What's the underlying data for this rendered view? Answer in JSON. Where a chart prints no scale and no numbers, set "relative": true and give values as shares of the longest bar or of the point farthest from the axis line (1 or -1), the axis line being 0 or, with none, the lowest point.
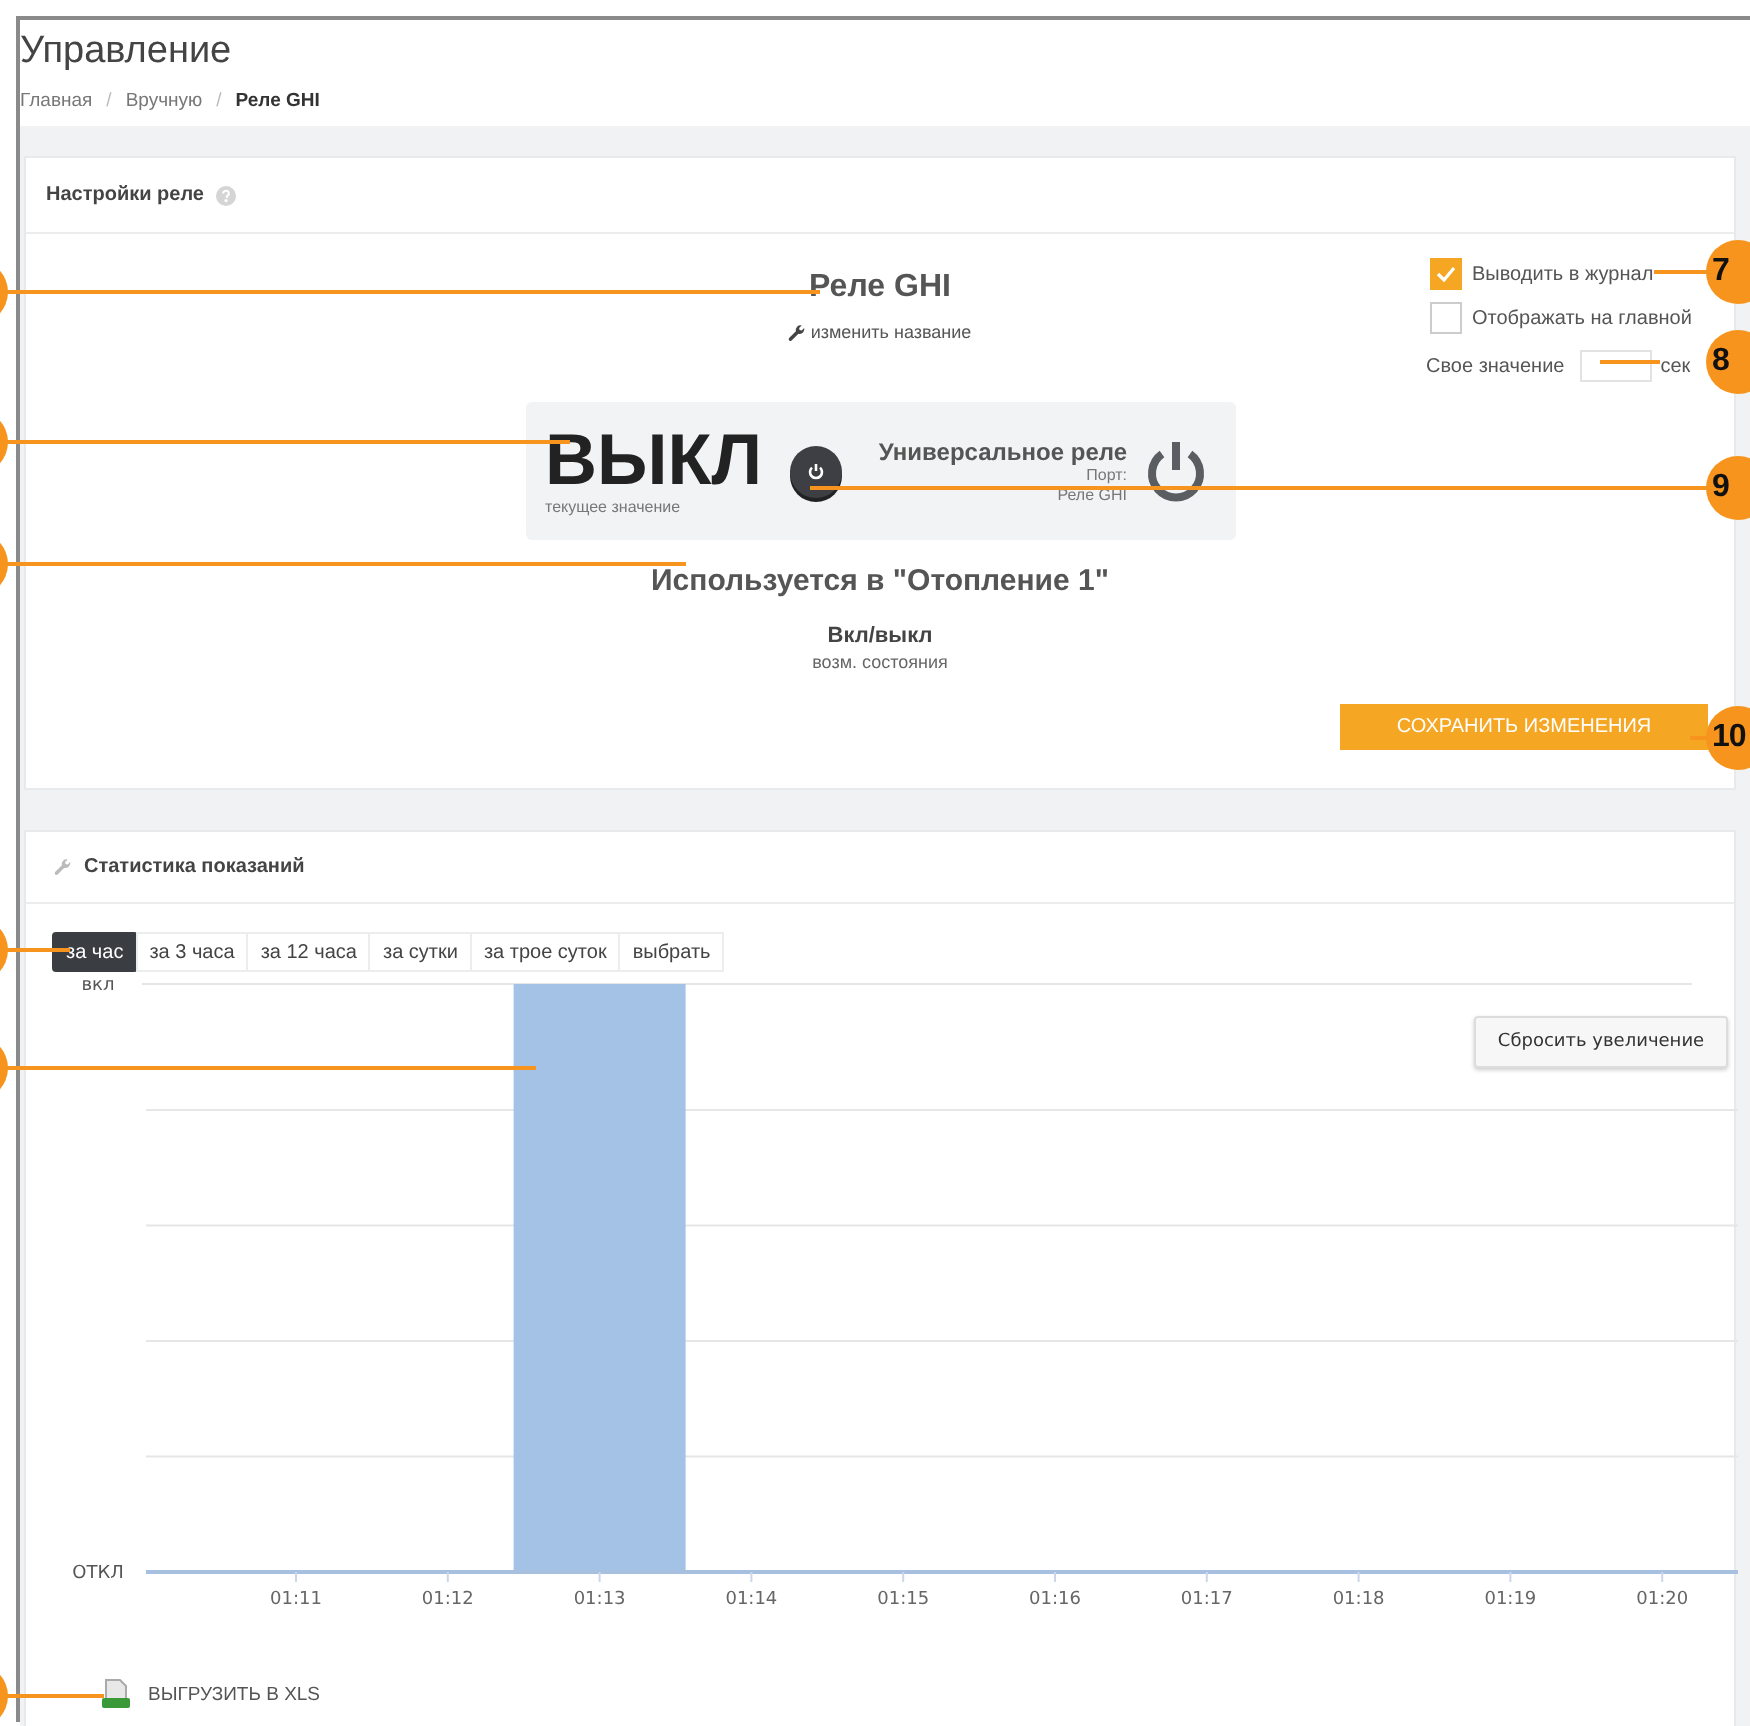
{
  "page": {
    "title": "Управление"
  },
  "breadcrumb": {
    "separator": "/",
    "items": [
      {
        "label": "Главная",
        "current": false
      },
      {
        "label": "Вручную",
        "current": false
      },
      {
        "label": "Реле GHI",
        "current": true
      }
    ]
  },
  "relay_settings": {
    "title": "Настройки реле",
    "relay_name": "Реле GHI",
    "rename_link": "изменить название",
    "state_value": "ВЫКЛ",
    "state_caption": "текущее значение",
    "switch_on": false,
    "relay_type": "Универсальное реле",
    "port_label": "Порт:",
    "port_value": "Реле GHI",
    "used_in": "Используется в \"Отопление 1\"",
    "states": "Вкл/выкл",
    "states_caption": "возм. состояния",
    "options": [
      {
        "label": "Выводить в журнал",
        "checked": true
      },
      {
        "label": "Отображать на главной",
        "checked": false
      }
    ],
    "custom_value": {
      "label": "Свое значение",
      "unit": "сек"
    },
    "save_button": "СОХРАНИТЬ ИЗМЕНЕНИЯ"
  },
  "statistics": {
    "title": "Статистика показаний",
    "tabs": [
      {
        "label": "за час",
        "selected": true
      },
      {
        "label": "за 3 часа",
        "selected": false
      },
      {
        "label": "за 12 часа",
        "selected": false
      },
      {
        "label": "за сутки",
        "selected": false
      },
      {
        "label": "за трое суток",
        "selected": false
      },
      {
        "label": "выбрать",
        "selected": false
      }
    ],
    "reset_zoom_button": "Сбросить увеличение",
    "chart_data": {
      "type": "bar",
      "categories": [
        "01:11",
        "01:12",
        "01:13",
        "01:14",
        "01:15",
        "01:16",
        "01:17",
        "01:18",
        "01:19",
        "01:20"
      ],
      "values": [
        0,
        0,
        1,
        0,
        0,
        0,
        0,
        0,
        0,
        0
      ],
      "relative": true
    },
    "y_axis_labels": [
      "вкл",
      "ОТКЛ"
    ],
    "export_link": "ВЫГРУЗИТЬ В XLS"
  },
  "callouts": [
    {
      "number": "7"
    },
    {
      "number": "8"
    },
    {
      "number": "9"
    },
    {
      "number": "10"
    }
  ]
}
